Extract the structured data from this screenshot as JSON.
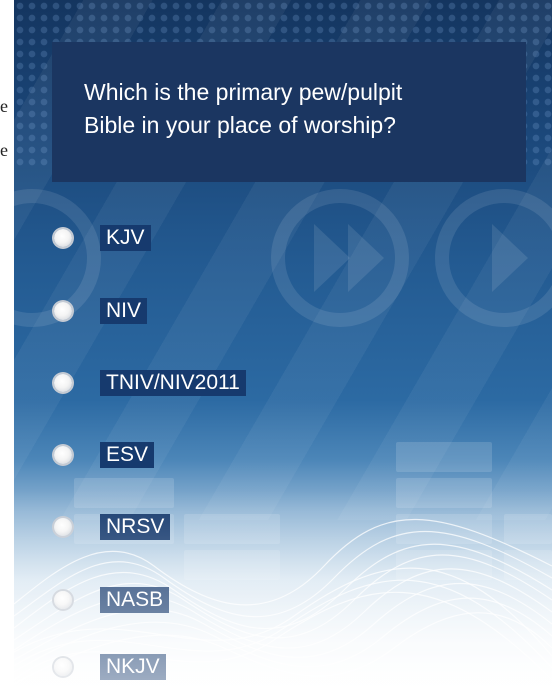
{
  "page": {
    "clipped_text_lines": [
      "e",
      "e"
    ]
  },
  "survey": {
    "question": {
      "line1": "Which is the primary pew/pulpit",
      "line2": "Bible in your place of worship?"
    },
    "options": [
      {
        "label": "KJV"
      },
      {
        "label": "NIV"
      },
      {
        "label": "TNIV/NIV2011"
      },
      {
        "label": "ESV"
      },
      {
        "label": "NRSV"
      },
      {
        "label": "NASB"
      },
      {
        "label": "NKJV"
      }
    ]
  },
  "colors": {
    "question_box_bg": "#1b3661",
    "label_bg": "#163a6e",
    "background_top": "#14355f",
    "background_mid": "#2c6aa3",
    "background_bottom": "#ffffff"
  }
}
